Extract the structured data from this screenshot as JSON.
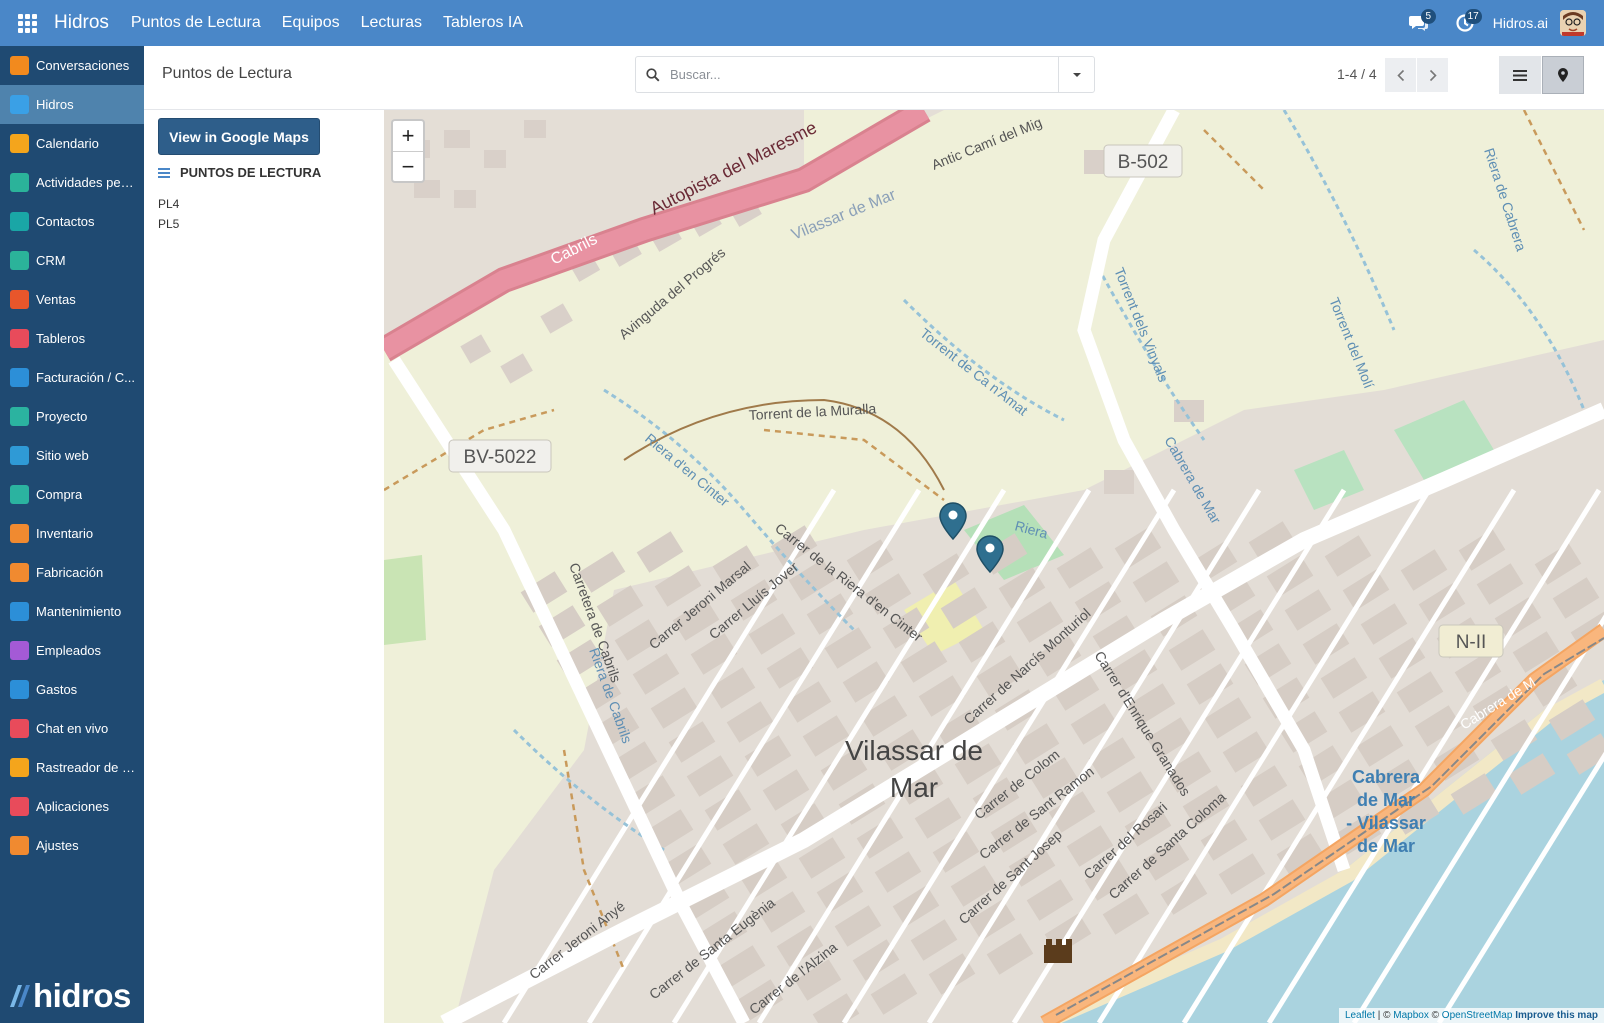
{
  "topbar": {
    "brand": "Hidros",
    "menu": [
      "Puntos de Lectura",
      "Equipos",
      "Lecturas",
      "Tableros IA"
    ],
    "messages_count": "5",
    "activities_count": "17",
    "company": "Hidros.ai"
  },
  "sidebar": {
    "items": [
      {
        "label": "Conversaciones",
        "icon": "conversations-icon",
        "color": "#f28a1e"
      },
      {
        "label": "Hidros",
        "icon": "hidros-icon",
        "color": "#3aa0e6"
      },
      {
        "label": "Calendario",
        "icon": "calendar-icon",
        "color": "#f4a51c"
      },
      {
        "label": "Actividades pen...",
        "icon": "activities-icon",
        "color": "#2bb39a"
      },
      {
        "label": "Contactos",
        "icon": "contacts-icon",
        "color": "#1aa6a6"
      },
      {
        "label": "CRM",
        "icon": "crm-icon",
        "color": "#2bb39a"
      },
      {
        "label": "Ventas",
        "icon": "sales-icon",
        "color": "#e8562b"
      },
      {
        "label": "Tableros",
        "icon": "dashboards-icon",
        "color": "#e84b5b"
      },
      {
        "label": "Facturación / C...",
        "icon": "invoicing-icon",
        "color": "#2c8fd8"
      },
      {
        "label": "Proyecto",
        "icon": "project-icon",
        "color": "#2bb3a0"
      },
      {
        "label": "Sitio web",
        "icon": "website-icon",
        "color": "#2f9ad6"
      },
      {
        "label": "Compra",
        "icon": "purchase-icon",
        "color": "#2bb3a0"
      },
      {
        "label": "Inventario",
        "icon": "inventory-icon",
        "color": "#f08a30"
      },
      {
        "label": "Fabricación",
        "icon": "manufacturing-icon",
        "color": "#f08a30"
      },
      {
        "label": "Mantenimiento",
        "icon": "maintenance-icon",
        "color": "#2c8fd8"
      },
      {
        "label": "Empleados",
        "icon": "employees-icon",
        "color": "#a45ad6"
      },
      {
        "label": "Gastos",
        "icon": "expenses-icon",
        "color": "#2c8fd8"
      },
      {
        "label": "Chat en vivo",
        "icon": "livechat-icon",
        "color": "#e84b5b"
      },
      {
        "label": "Rastreador de e...",
        "icon": "tracker-icon",
        "color": "#f4a51c"
      },
      {
        "label": "Aplicaciones",
        "icon": "apps-icon",
        "color": "#e84b5b"
      },
      {
        "label": "Ajustes",
        "icon": "settings-icon",
        "color": "#f08a30"
      }
    ],
    "active_index": 1,
    "logo_text": "hidros"
  },
  "control": {
    "breadcrumb": "Puntos de Lectura",
    "search_placeholder": "Buscar...",
    "pager": "1-4 / 4"
  },
  "list_panel": {
    "google_maps_button": "View in Google Maps",
    "title": "PUNTOS DE LECTURA",
    "items": [
      "PL4",
      "PL5"
    ]
  },
  "map": {
    "zoom_in": "+",
    "zoom_out": "−",
    "labels": {
      "town": [
        "Vilassar de",
        "Mar"
      ],
      "cabrera": [
        "Cabrera",
        "de Mar",
        "- Vilassar",
        "de Mar"
      ],
      "b502": "B-502",
      "bv5022": "BV-5022",
      "n2": "N-II",
      "autopista": "Autopista del Maresme",
      "cabrils": "Cabrils",
      "vilassar_road": "Vilassar de Mar",
      "antic_cami": "Antic Camí del Mig",
      "avinguda": "Avinguda del Progrés",
      "torrent_muralla": "Torrent de la Muralla",
      "torrent_ca_namat": "Torrent de Ca n'Amat",
      "torrent_vinyals": "Torrent dels Vinyals",
      "torrent_moli": "Torrent del Molí",
      "riera_cabrera": "Riera de Cabrera",
      "riera_cinter": "Riera d'en Cinter",
      "cabrera_de_mar": "Cabrera de Mar",
      "carretera_cabrils": "Carretera de Cabrils",
      "riera_cabrils": "Riera de Cabrils",
      "jeroni_marsal": "Carrer Jeroni Marsal",
      "lluis_jover": "Carrer Lluís Jover",
      "riera_cinter_st": "Carrer de la Riera d'en Cinter",
      "narcis": "Carrer de Narcís Monturiol",
      "enrique": "Carrer d'Enrique Granados",
      "colom": "Carrer de Colom",
      "sant_ramon": "Carrer de Sant Ramon",
      "sant_josep": "Carrer de Sant Josep",
      "rosari": "Carrer del Rosari",
      "santa_coloma": "Carrer de Santa Coloma",
      "jeroni_anye": "Carrer Jeroni Anyé",
      "santa_eugenia": "Carrer de Santa Eugènia",
      "alzina": "Carrer de l'Alzina",
      "riera": "Riera",
      "cabrera_coast": "Cabrera de M"
    },
    "attribution": {
      "leaflet": "Leaflet",
      "sep1": " | © ",
      "mapbox": "Mapbox",
      "sep2": " © ",
      "osm": "OpenStreetMap",
      "improve": "Improve this map"
    },
    "colors": {
      "land": "#eff0d9",
      "urban": "#e3ddd7",
      "water": "#aad3df",
      "motorway": "#e892a2",
      "trunk": "#f9b67d",
      "park": "#c8e6b6",
      "marker": "#2f6f8f"
    }
  }
}
